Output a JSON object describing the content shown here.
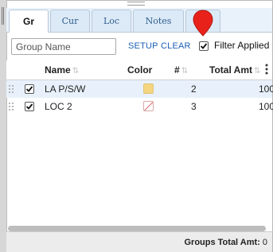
{
  "tabs": [
    {
      "label": "Gr",
      "active": true
    },
    {
      "label": "Cur",
      "active": false
    },
    {
      "label": "Loc",
      "active": false
    },
    {
      "label": "Notes",
      "active": false
    },
    {
      "label": "",
      "active": false
    }
  ],
  "toolbar": {
    "group_name_placeholder": "Group Name",
    "setup_label": "SETUP",
    "clear_label": "CLEAR",
    "filter_checked": true,
    "filter_label": "Filter Applied"
  },
  "grid": {
    "columns": {
      "name": "Name",
      "color": "Color",
      "count": "#",
      "total_amt": "Total Amt"
    },
    "rows": [
      {
        "checked": true,
        "name": "LA P/S/W",
        "color": "#f5d67e",
        "count": "2",
        "total_amt": "100",
        "selected": true
      },
      {
        "checked": true,
        "name": "LOC 2",
        "color": "none",
        "count": "3",
        "total_amt": "100",
        "selected": false
      }
    ]
  },
  "footer": {
    "label": "Groups Total Amt:",
    "value": "0"
  },
  "colors": {
    "accent": "#1a5fb4",
    "tab_bg": "#dceaf7",
    "pin_marker": "#e8221b",
    "selected_row": "#e8f1fb"
  },
  "icons": {
    "pin": "map-pin-icon",
    "row_handle": "drag-handle-icon",
    "column_menu": "kebab-menu-icon"
  }
}
